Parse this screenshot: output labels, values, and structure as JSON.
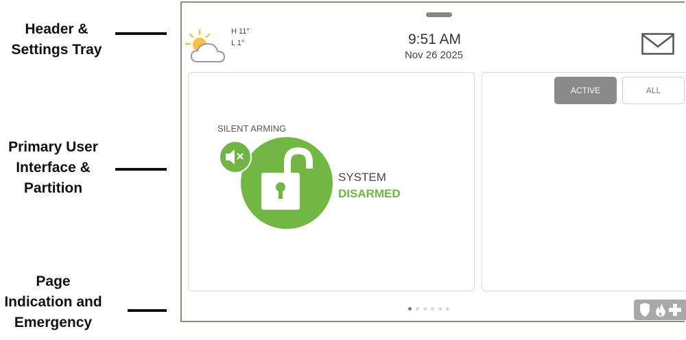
{
  "annotations": {
    "header": [
      "Header &",
      "Settings Tray"
    ],
    "primary": [
      "Primary User",
      "Interface &",
      "Partition"
    ],
    "page": [
      "Page",
      "Indication and",
      "Emergency"
    ]
  },
  "header": {
    "temp_high": "H 11°",
    "temp_low": "L 1°",
    "time": "9:51 AM",
    "date": "Nov 26 2025"
  },
  "main": {
    "silent_arming_label": "SILENT ARMING",
    "system_label": "SYSTEM",
    "system_status": "DISARMED"
  },
  "side": {
    "tab_active_label": "ACTIVE",
    "tab_all_label": "ALL"
  },
  "pagination": {
    "total_pages": 6,
    "current_page": 1
  },
  "colors": {
    "status_green": "#72b743",
    "tab_active_bg": "#8a8a8a",
    "emergency_bg": "#a8a8a8"
  }
}
